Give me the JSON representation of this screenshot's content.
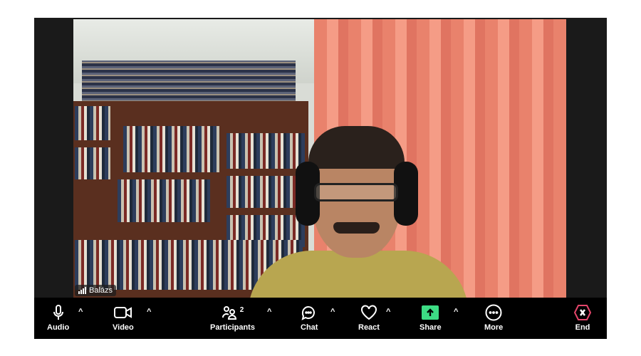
{
  "participant": {
    "name": "Balázs"
  },
  "toolbar": {
    "audio": "Audio",
    "video": "Video",
    "participants": "Participants",
    "participant_count": "2",
    "chat": "Chat",
    "react": "React",
    "share": "Share",
    "more": "More",
    "end": "End"
  },
  "colors": {
    "share": "#3ddc84",
    "end": "#e5466b"
  }
}
